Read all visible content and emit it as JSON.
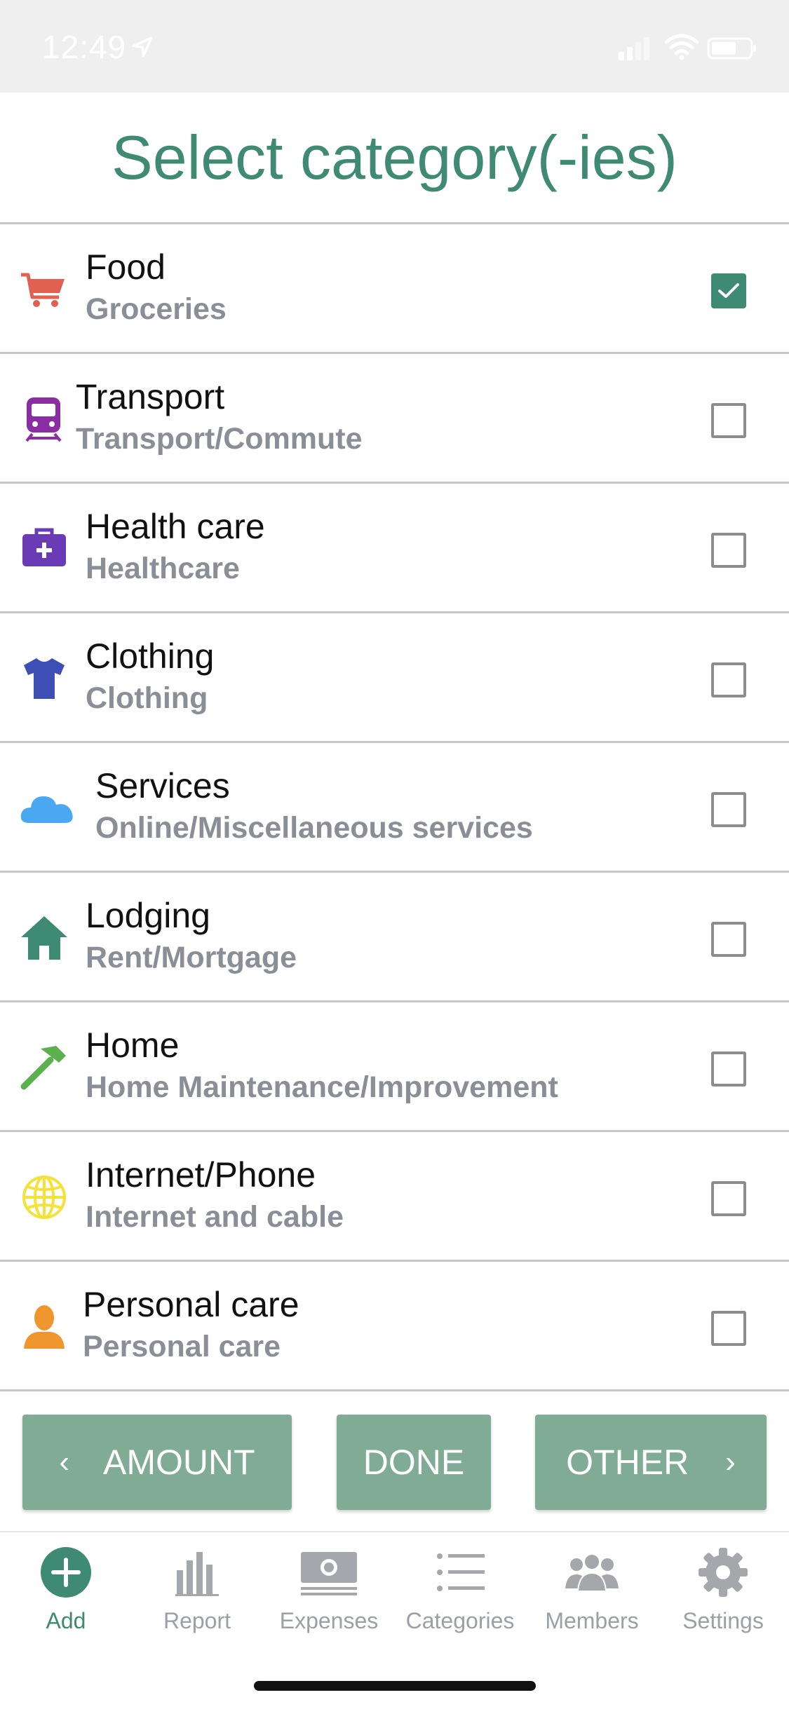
{
  "status_bar": {
    "time": "12:49"
  },
  "header": {
    "title": "Select category(-ies)"
  },
  "categories": [
    {
      "name": "Food",
      "subtitle": "Groceries",
      "checked": true,
      "icon": "shopping-cart-icon",
      "color": "#e06052"
    },
    {
      "name": "Transport",
      "subtitle": "Transport/Commute",
      "checked": false,
      "icon": "train-icon",
      "color": "#8b2ea3"
    },
    {
      "name": "Health care",
      "subtitle": "Healthcare",
      "checked": false,
      "icon": "medical-kit-icon",
      "color": "#6a3bb5"
    },
    {
      "name": "Clothing",
      "subtitle": "Clothing",
      "checked": false,
      "icon": "shirt-icon",
      "color": "#3d4fb5"
    },
    {
      "name": "Services",
      "subtitle": "Online/Miscellaneous services",
      "checked": false,
      "icon": "cloud-icon",
      "color": "#4aa8f0"
    },
    {
      "name": "Lodging",
      "subtitle": "Rent/Mortgage",
      "checked": false,
      "icon": "house-icon",
      "color": "#3f8a72"
    },
    {
      "name": "Home",
      "subtitle": "Home Maintenance/Improvement",
      "checked": false,
      "icon": "hammer-icon",
      "color": "#5db04f"
    },
    {
      "name": "Internet/Phone",
      "subtitle": "Internet and cable",
      "checked": false,
      "icon": "globe-icon",
      "color": "#f2e23a"
    },
    {
      "name": "Personal care",
      "subtitle": "Personal care",
      "checked": false,
      "icon": "person-icon",
      "color": "#f0962e"
    }
  ],
  "actions": {
    "amount_label": "AMOUNT",
    "done_label": "DONE",
    "other_label": "OTHER"
  },
  "tabs": [
    {
      "label": "Add",
      "icon": "add-circle-icon",
      "active": true
    },
    {
      "label": "Report",
      "icon": "bar-chart-icon",
      "active": false
    },
    {
      "label": "Expenses",
      "icon": "banknote-icon",
      "active": false
    },
    {
      "label": "Categories",
      "icon": "list-icon",
      "active": false
    },
    {
      "label": "Members",
      "icon": "group-icon",
      "active": false
    },
    {
      "label": "Settings",
      "icon": "gear-icon",
      "active": false
    }
  ],
  "colors": {
    "accent": "#3f8a72",
    "button": "#80ab94",
    "inactive_tab": "#9aa0a6",
    "subtitle": "#8a8e96"
  }
}
